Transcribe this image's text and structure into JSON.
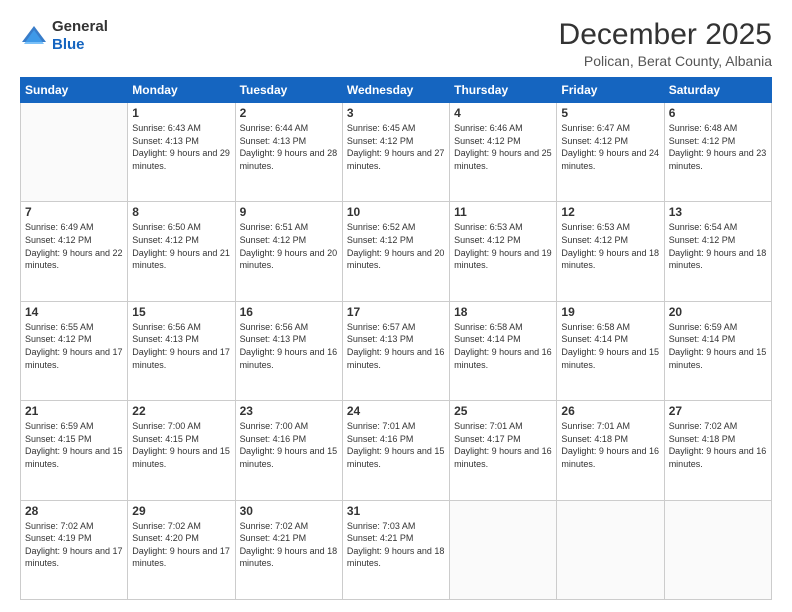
{
  "logo": {
    "general": "General",
    "blue": "Blue"
  },
  "header": {
    "month": "December 2025",
    "location": "Polican, Berat County, Albania"
  },
  "weekdays": [
    "Sunday",
    "Monday",
    "Tuesday",
    "Wednesday",
    "Thursday",
    "Friday",
    "Saturday"
  ],
  "weeks": [
    [
      {
        "day": "",
        "sunrise": "",
        "sunset": "",
        "daylight": ""
      },
      {
        "day": "1",
        "sunrise": "Sunrise: 6:43 AM",
        "sunset": "Sunset: 4:13 PM",
        "daylight": "Daylight: 9 hours and 29 minutes."
      },
      {
        "day": "2",
        "sunrise": "Sunrise: 6:44 AM",
        "sunset": "Sunset: 4:13 PM",
        "daylight": "Daylight: 9 hours and 28 minutes."
      },
      {
        "day": "3",
        "sunrise": "Sunrise: 6:45 AM",
        "sunset": "Sunset: 4:12 PM",
        "daylight": "Daylight: 9 hours and 27 minutes."
      },
      {
        "day": "4",
        "sunrise": "Sunrise: 6:46 AM",
        "sunset": "Sunset: 4:12 PM",
        "daylight": "Daylight: 9 hours and 25 minutes."
      },
      {
        "day": "5",
        "sunrise": "Sunrise: 6:47 AM",
        "sunset": "Sunset: 4:12 PM",
        "daylight": "Daylight: 9 hours and 24 minutes."
      },
      {
        "day": "6",
        "sunrise": "Sunrise: 6:48 AM",
        "sunset": "Sunset: 4:12 PM",
        "daylight": "Daylight: 9 hours and 23 minutes."
      }
    ],
    [
      {
        "day": "7",
        "sunrise": "Sunrise: 6:49 AM",
        "sunset": "Sunset: 4:12 PM",
        "daylight": "Daylight: 9 hours and 22 minutes."
      },
      {
        "day": "8",
        "sunrise": "Sunrise: 6:50 AM",
        "sunset": "Sunset: 4:12 PM",
        "daylight": "Daylight: 9 hours and 21 minutes."
      },
      {
        "day": "9",
        "sunrise": "Sunrise: 6:51 AM",
        "sunset": "Sunset: 4:12 PM",
        "daylight": "Daylight: 9 hours and 20 minutes."
      },
      {
        "day": "10",
        "sunrise": "Sunrise: 6:52 AM",
        "sunset": "Sunset: 4:12 PM",
        "daylight": "Daylight: 9 hours and 20 minutes."
      },
      {
        "day": "11",
        "sunrise": "Sunrise: 6:53 AM",
        "sunset": "Sunset: 4:12 PM",
        "daylight": "Daylight: 9 hours and 19 minutes."
      },
      {
        "day": "12",
        "sunrise": "Sunrise: 6:53 AM",
        "sunset": "Sunset: 4:12 PM",
        "daylight": "Daylight: 9 hours and 18 minutes."
      },
      {
        "day": "13",
        "sunrise": "Sunrise: 6:54 AM",
        "sunset": "Sunset: 4:12 PM",
        "daylight": "Daylight: 9 hours and 18 minutes."
      }
    ],
    [
      {
        "day": "14",
        "sunrise": "Sunrise: 6:55 AM",
        "sunset": "Sunset: 4:12 PM",
        "daylight": "Daylight: 9 hours and 17 minutes."
      },
      {
        "day": "15",
        "sunrise": "Sunrise: 6:56 AM",
        "sunset": "Sunset: 4:13 PM",
        "daylight": "Daylight: 9 hours and 17 minutes."
      },
      {
        "day": "16",
        "sunrise": "Sunrise: 6:56 AM",
        "sunset": "Sunset: 4:13 PM",
        "daylight": "Daylight: 9 hours and 16 minutes."
      },
      {
        "day": "17",
        "sunrise": "Sunrise: 6:57 AM",
        "sunset": "Sunset: 4:13 PM",
        "daylight": "Daylight: 9 hours and 16 minutes."
      },
      {
        "day": "18",
        "sunrise": "Sunrise: 6:58 AM",
        "sunset": "Sunset: 4:14 PM",
        "daylight": "Daylight: 9 hours and 16 minutes."
      },
      {
        "day": "19",
        "sunrise": "Sunrise: 6:58 AM",
        "sunset": "Sunset: 4:14 PM",
        "daylight": "Daylight: 9 hours and 15 minutes."
      },
      {
        "day": "20",
        "sunrise": "Sunrise: 6:59 AM",
        "sunset": "Sunset: 4:14 PM",
        "daylight": "Daylight: 9 hours and 15 minutes."
      }
    ],
    [
      {
        "day": "21",
        "sunrise": "Sunrise: 6:59 AM",
        "sunset": "Sunset: 4:15 PM",
        "daylight": "Daylight: 9 hours and 15 minutes."
      },
      {
        "day": "22",
        "sunrise": "Sunrise: 7:00 AM",
        "sunset": "Sunset: 4:15 PM",
        "daylight": "Daylight: 9 hours and 15 minutes."
      },
      {
        "day": "23",
        "sunrise": "Sunrise: 7:00 AM",
        "sunset": "Sunset: 4:16 PM",
        "daylight": "Daylight: 9 hours and 15 minutes."
      },
      {
        "day": "24",
        "sunrise": "Sunrise: 7:01 AM",
        "sunset": "Sunset: 4:16 PM",
        "daylight": "Daylight: 9 hours and 15 minutes."
      },
      {
        "day": "25",
        "sunrise": "Sunrise: 7:01 AM",
        "sunset": "Sunset: 4:17 PM",
        "daylight": "Daylight: 9 hours and 16 minutes."
      },
      {
        "day": "26",
        "sunrise": "Sunrise: 7:01 AM",
        "sunset": "Sunset: 4:18 PM",
        "daylight": "Daylight: 9 hours and 16 minutes."
      },
      {
        "day": "27",
        "sunrise": "Sunrise: 7:02 AM",
        "sunset": "Sunset: 4:18 PM",
        "daylight": "Daylight: 9 hours and 16 minutes."
      }
    ],
    [
      {
        "day": "28",
        "sunrise": "Sunrise: 7:02 AM",
        "sunset": "Sunset: 4:19 PM",
        "daylight": "Daylight: 9 hours and 17 minutes."
      },
      {
        "day": "29",
        "sunrise": "Sunrise: 7:02 AM",
        "sunset": "Sunset: 4:20 PM",
        "daylight": "Daylight: 9 hours and 17 minutes."
      },
      {
        "day": "30",
        "sunrise": "Sunrise: 7:02 AM",
        "sunset": "Sunset: 4:21 PM",
        "daylight": "Daylight: 9 hours and 18 minutes."
      },
      {
        "day": "31",
        "sunrise": "Sunrise: 7:03 AM",
        "sunset": "Sunset: 4:21 PM",
        "daylight": "Daylight: 9 hours and 18 minutes."
      },
      {
        "day": "",
        "sunrise": "",
        "sunset": "",
        "daylight": ""
      },
      {
        "day": "",
        "sunrise": "",
        "sunset": "",
        "daylight": ""
      },
      {
        "day": "",
        "sunrise": "",
        "sunset": "",
        "daylight": ""
      }
    ]
  ]
}
